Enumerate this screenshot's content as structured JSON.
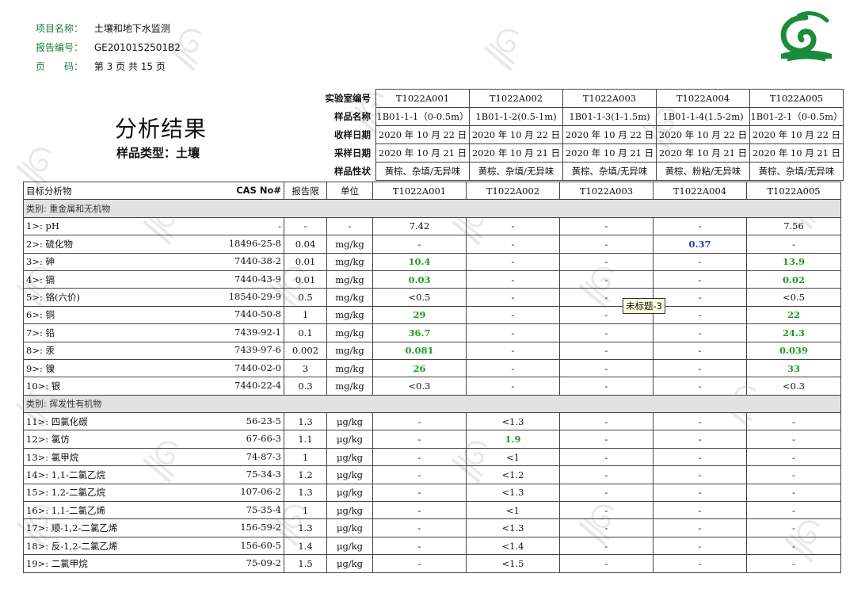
{
  "header": {
    "project_label": "项目名称：",
    "project_value": "土壤和地下水监测",
    "report_label": "报告编号：",
    "report_value": "GE2010152501B2",
    "page_label": "页　　码：",
    "page_value": "第 3 页 共 15 页"
  },
  "logo": {
    "icon": "green-spiral-logo",
    "color": "#1b8a3a"
  },
  "title": "分析结果",
  "subtitle": "样品类型：土壤",
  "meta": {
    "rows": [
      {
        "label": "实验室编号",
        "cells": [
          "T1022A001",
          "T1022A002",
          "T1022A003",
          "T1022A004",
          "T1022A005"
        ]
      },
      {
        "label": "样品名称",
        "cells": [
          "1B01-1-1（0-0.5m）",
          "1B01-1-2(0.5-1m)",
          "1B01-1-3(1-1.5m)",
          "1B01-1-4(1.5-2m)",
          "1B01-2-1（0-0.5m）"
        ]
      },
      {
        "label": "收样日期",
        "cells": [
          "2020 年 10 月 22 日",
          "2020 年 10 月 22 日",
          "2020 年 10 月 22 日",
          "2020 年 10 月 22 日",
          "2020 年 10 月 22 日"
        ]
      },
      {
        "label": "采样日期",
        "cells": [
          "2020 年 10 月 21 日",
          "2020 年 10 月 21 日",
          "2020 年 10 月 21 日",
          "2020 年 10 月 21 日",
          "2020 年 10 月 21 日"
        ]
      },
      {
        "label": "样品性状",
        "cells": [
          "黄棕、杂填/无异味",
          "黄棕、杂填/无异味",
          "黄棕、杂填/无异味",
          "黄棕、粉粘/无异味",
          "黄棕、杂填/无异味"
        ]
      }
    ]
  },
  "table": {
    "headers": {
      "analyte": "目标分析物",
      "cas": "CAS No#",
      "limit": "报告限",
      "unit": "单位",
      "samples": [
        "T1022A001",
        "T1022A002",
        "T1022A003",
        "T1022A004",
        "T1022A005"
      ]
    },
    "categories": [
      {
        "title": "类别:  重金属和无机物",
        "rows": [
          {
            "name": "1>: pH",
            "cas": "-",
            "limit": "-",
            "unit": "-",
            "values": [
              "7.42",
              "-",
              "-",
              "-",
              "7.56"
            ],
            "hl": [
              "",
              "",
              "",
              "",
              ""
            ]
          },
          {
            "name": "2>: 硫化物",
            "cas": "18496-25-8",
            "limit": "0.04",
            "unit": "mg/kg",
            "values": [
              "-",
              "-",
              "-",
              "0.37",
              "-"
            ],
            "hl": [
              "",
              "",
              "",
              "blue",
              ""
            ]
          },
          {
            "name": "3>: 砷",
            "cas": "7440-38-2",
            "limit": "0.01",
            "unit": "mg/kg",
            "values": [
              "10.4",
              "-",
              "-",
              "-",
              "13.9"
            ],
            "hl": [
              "green",
              "",
              "",
              "",
              "green"
            ]
          },
          {
            "name": "4>: 镉",
            "cas": "7440-43-9",
            "limit": "0.01",
            "unit": "mg/kg",
            "values": [
              "0.03",
              "-",
              "-",
              "-",
              "0.02"
            ],
            "hl": [
              "green",
              "",
              "",
              "",
              "green"
            ]
          },
          {
            "name": "5>: 铬(六价)",
            "cas": "18540-29-9",
            "limit": "0.5",
            "unit": "mg/kg",
            "values": [
              "<0.5",
              "-",
              "-",
              "-",
              "<0.5"
            ],
            "hl": [
              "",
              "",
              "",
              "",
              ""
            ]
          },
          {
            "name": "6>: 铜",
            "cas": "7440-50-8",
            "limit": "1",
            "unit": "mg/kg",
            "values": [
              "29",
              "-",
              "-",
              "-",
              "22"
            ],
            "hl": [
              "green",
              "",
              "",
              "",
              "green"
            ]
          },
          {
            "name": "7>: 铅",
            "cas": "7439-92-1",
            "limit": "0.1",
            "unit": "mg/kg",
            "values": [
              "36.7",
              "-",
              "-",
              "-",
              "24.3"
            ],
            "hl": [
              "green",
              "",
              "",
              "",
              "green"
            ]
          },
          {
            "name": "8>: 汞",
            "cas": "7439-97-6",
            "limit": "0.002",
            "unit": "mg/kg",
            "values": [
              "0.081",
              "-",
              "-",
              "-",
              "0.039"
            ],
            "hl": [
              "green",
              "",
              "",
              "",
              "green"
            ]
          },
          {
            "name": "9>: 镍",
            "cas": "7440-02-0",
            "limit": "3",
            "unit": "mg/kg",
            "values": [
              "26",
              "-",
              "-",
              "-",
              "33"
            ],
            "hl": [
              "green",
              "",
              "",
              "",
              "green"
            ]
          },
          {
            "name": "10>: 银",
            "cas": "7440-22-4",
            "limit": "0.3",
            "unit": "mg/kg",
            "values": [
              "<0.3",
              "-",
              "-",
              "-",
              "<0.3"
            ],
            "hl": [
              "",
              "",
              "",
              "",
              ""
            ]
          }
        ]
      },
      {
        "title": "类别:  挥发性有机物",
        "rows": [
          {
            "name": "11>: 四氯化碳",
            "cas": "56-23-5",
            "limit": "1.3",
            "unit": "μg/kg",
            "values": [
              "-",
              "<1.3",
              "-",
              "-",
              "-"
            ],
            "hl": [
              "",
              "",
              "",
              "",
              ""
            ]
          },
          {
            "name": "12>: 氯仿",
            "cas": "67-66-3",
            "limit": "1.1",
            "unit": "μg/kg",
            "values": [
              "-",
              "1.9",
              "-",
              "-",
              "-"
            ],
            "hl": [
              "",
              "green",
              "",
              "",
              ""
            ]
          },
          {
            "name": "13>: 氯甲烷",
            "cas": "74-87-3",
            "limit": "1",
            "unit": "μg/kg",
            "values": [
              "-",
              "<1",
              "-",
              "-",
              "-"
            ],
            "hl": [
              "",
              "",
              "",
              "",
              ""
            ]
          },
          {
            "name": "14>: 1,1-二氯乙烷",
            "cas": "75-34-3",
            "limit": "1.2",
            "unit": "μg/kg",
            "values": [
              "-",
              "<1.2",
              "-",
              "-",
              "-"
            ],
            "hl": [
              "",
              "",
              "",
              "",
              ""
            ]
          },
          {
            "name": "15>: 1,2-二氯乙烷",
            "cas": "107-06-2",
            "limit": "1.3",
            "unit": "μg/kg",
            "values": [
              "-",
              "<1.3",
              "-",
              "-",
              "-"
            ],
            "hl": [
              "",
              "",
              "",
              "",
              ""
            ]
          },
          {
            "name": "16>: 1,1-二氯乙烯",
            "cas": "75-35-4",
            "limit": "1",
            "unit": "μg/kg",
            "values": [
              "-",
              "<1",
              "-",
              "-",
              "-"
            ],
            "hl": [
              "",
              "",
              "",
              "",
              ""
            ]
          },
          {
            "name": "17>: 顺-1,2-二氯乙烯",
            "cas": "156-59-2",
            "limit": "1.3",
            "unit": "μg/kg",
            "values": [
              "-",
              "<1.3",
              "-",
              "-",
              "-"
            ],
            "hl": [
              "",
              "",
              "",
              "",
              ""
            ]
          },
          {
            "name": "18>: 反-1,2-二氯乙烯",
            "cas": "156-60-5",
            "limit": "1.4",
            "unit": "μg/kg",
            "values": [
              "-",
              "<1.4",
              "-",
              "-",
              "-"
            ],
            "hl": [
              "",
              "",
              "",
              "",
              ""
            ]
          },
          {
            "name": "19>: 二氯甲烷",
            "cas": "75-09-2",
            "limit": "1.5",
            "unit": "μg/kg",
            "values": [
              "-",
              "<1.5",
              "-",
              "-",
              "-"
            ],
            "hl": [
              "",
              "",
              "",
              "",
              ""
            ]
          }
        ]
      }
    ]
  },
  "tooltip": "未标题-3",
  "colors": {
    "accent_green": "#1f9a22",
    "highlight_blue": "#1a3ea8",
    "label_green": "#1b7d3d",
    "category_bg": "#e2e2e2"
  }
}
